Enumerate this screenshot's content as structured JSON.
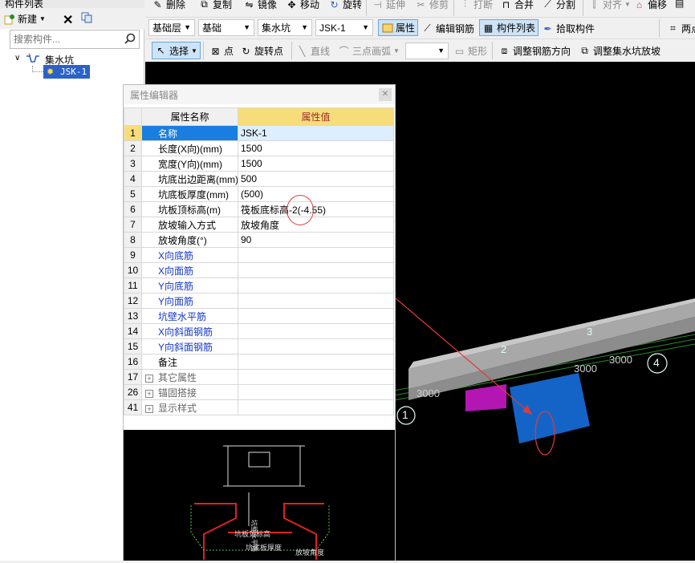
{
  "left_panel": {
    "title": "构件列表",
    "new_label": "新建",
    "search_placeholder": "搜索构件...",
    "tree_root": "集水坑",
    "tree_child": "JSK-1"
  },
  "toolbar1": {
    "delete": "删除",
    "copy": "复制",
    "mirror": "镜像",
    "move": "移动",
    "rotate": "旋转",
    "extend": "延伸",
    "trim": "修剪",
    "break": "打断",
    "merge": "合并",
    "split": "分割",
    "align": "对齐",
    "offset": "偏移"
  },
  "toolbar2": {
    "floor": "基础层",
    "category": "基础",
    "type": "集水坑",
    "component": "JSK-1",
    "property": "属性",
    "edit_rebar": "编辑钢筋",
    "component_list": "构件列表",
    "pick": "拾取构件",
    "two_points": "两点"
  },
  "toolbar3": {
    "select": "选择",
    "point": "点",
    "rotate_point": "旋转点",
    "line": "直线",
    "arc": "三点画弧",
    "rect": "矩形",
    "adjust_rebar": "调整钢筋方向",
    "adjust_slope": "调整集水坑放坡"
  },
  "prop_editor": {
    "title": "属性编辑器",
    "col_name": "属性名称",
    "col_value": "属性值",
    "rows": [
      {
        "no": "1",
        "name": "名称",
        "value": "JSK-1"
      },
      {
        "no": "2",
        "name": "长度(X向)(mm)",
        "value": "1500"
      },
      {
        "no": "3",
        "name": "宽度(Y向)(mm)",
        "value": "1500"
      },
      {
        "no": "4",
        "name": "坑底出边距离(mm)",
        "value": "500"
      },
      {
        "no": "5",
        "name": "坑底板厚度(mm)",
        "value": "(500)"
      },
      {
        "no": "6",
        "name": "坑板顶标高(m)",
        "value": "筏板底标高-2(-4.55)"
      },
      {
        "no": "7",
        "name": "放坡输入方式",
        "value": "放坡角度"
      },
      {
        "no": "8",
        "name": "放坡角度(°)",
        "value": "90"
      },
      {
        "no": "9",
        "name": "X向底筋",
        "value": ""
      },
      {
        "no": "10",
        "name": "X向面筋",
        "value": ""
      },
      {
        "no": "11",
        "name": "Y向底筋",
        "value": ""
      },
      {
        "no": "12",
        "name": "Y向面筋",
        "value": ""
      },
      {
        "no": "13",
        "name": "坑壁水平筋",
        "value": ""
      },
      {
        "no": "14",
        "name": "X向斜面钢筋",
        "value": ""
      },
      {
        "no": "15",
        "name": "Y向斜面钢筋",
        "value": ""
      },
      {
        "no": "16",
        "name": "备注",
        "value": ""
      },
      {
        "no": "17",
        "name": "其它属性",
        "value": ""
      },
      {
        "no": "26",
        "name": "锚固搭接",
        "value": ""
      },
      {
        "no": "41",
        "name": "显示样式",
        "value": ""
      }
    ]
  },
  "canvas": {
    "axis_labels": [
      "1",
      "2",
      "3",
      "4"
    ],
    "dims": [
      "3000",
      "3000",
      "3000"
    ],
    "drawing_labels": [
      "坑板顶标高",
      "坑底板厚度",
      "放坡角度",
      "坑壁水平筋"
    ]
  }
}
